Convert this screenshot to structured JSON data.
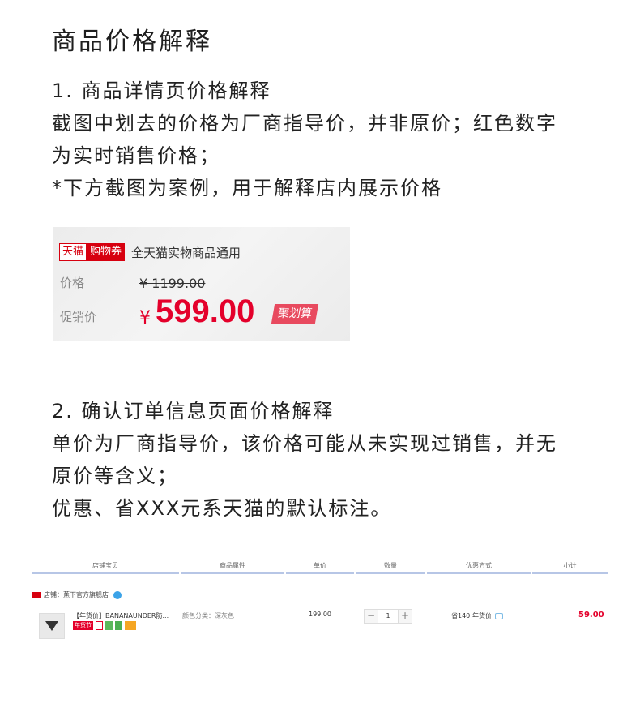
{
  "title": "商品价格解释",
  "section1": {
    "lines": [
      "1. 商品详情页价格解释",
      "截图中划去的价格为厂商指导价，并非原价；红色数字",
      "为实时销售价格；",
      "*下方截图为案例，用于解释店内展示价格"
    ]
  },
  "price_card": {
    "tmall_badge": "天猫",
    "coupon_badge": "购物券",
    "coupon_desc": "全天猫实物商品通用",
    "price_label": "价格",
    "original_price": "¥ 1199.00",
    "promo_label": "促销价",
    "currency": "¥",
    "promo_price": "599.00",
    "juhuasuan_badge": "聚划算"
  },
  "section2": {
    "lines": [
      "2. 确认订单信息页面价格解释",
      "单价为厂商指导价，该价格可能从未实现过销售，并无",
      "原价等含义；",
      "优惠、省XXX元系天猫的默认标注。"
    ]
  },
  "order_table": {
    "headers": [
      "店铺宝贝",
      "商品属性",
      "单价",
      "数量",
      "优惠方式",
      "小计"
    ],
    "shop_label": "店铺：蕉下官方旗舰店",
    "item_name": "【年货价】BANANAUNDER防...",
    "item_tag": "年货节",
    "item_attr": "颜色分类：深灰色",
    "unit_price": "199.00",
    "quantity": "1",
    "qty_minus": "−",
    "qty_plus": "+",
    "discount": "省140:年货价",
    "subtotal": "59.00"
  }
}
